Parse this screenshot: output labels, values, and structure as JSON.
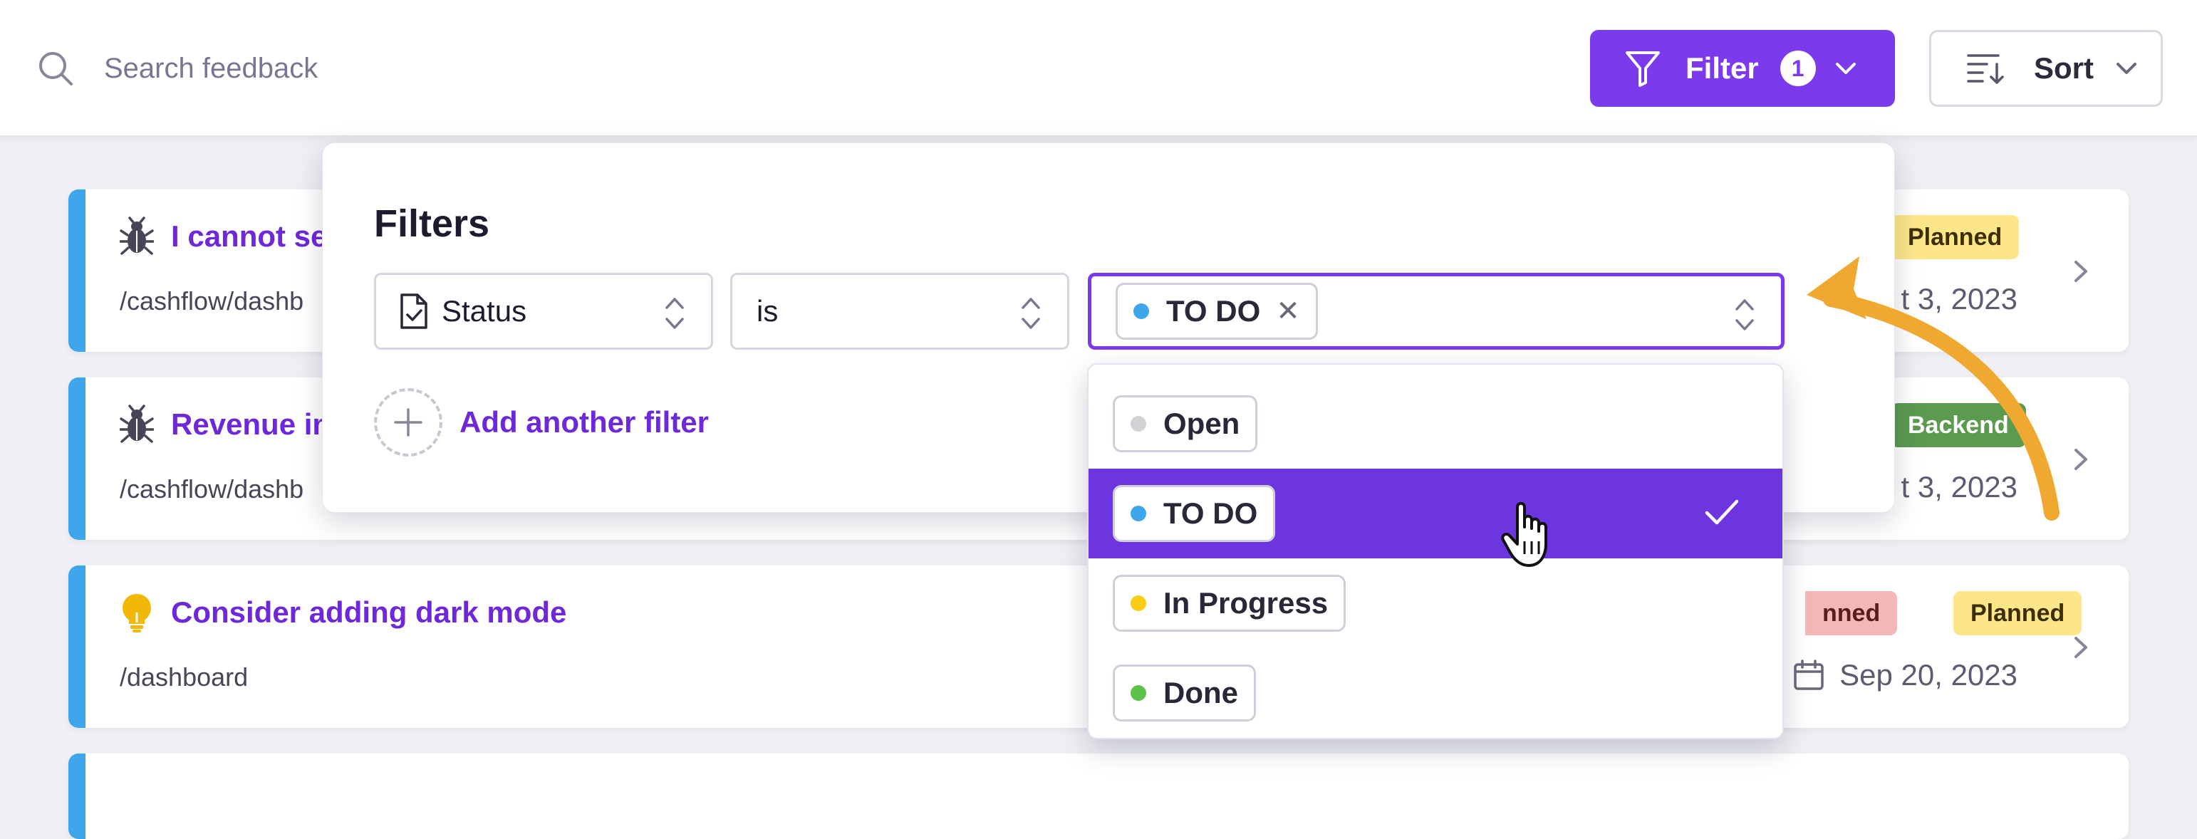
{
  "topbar": {
    "search_placeholder": "Search feedback",
    "filter_label": "Filter",
    "filter_count": "1",
    "sort_label": "Sort",
    "accent_color": "#7c3aed"
  },
  "cards": [
    {
      "type_icon": "bug-icon",
      "title": "I cannot se",
      "path": "/cashflow/dashb",
      "tags": [
        "Planned"
      ],
      "date": "t 3, 2023"
    },
    {
      "type_icon": "bug-icon",
      "title": "Revenue in",
      "path": "/cashflow/dashb",
      "tags": [
        "Backend"
      ],
      "date": "t 3, 2023"
    },
    {
      "type_icon": "lightbulb-icon",
      "title": "Consider adding dark mode",
      "path": "/dashboard",
      "tags": [
        "nned",
        "Planned"
      ],
      "date": "Sep 20, 2023"
    }
  ],
  "filters": {
    "heading": "Filters",
    "field": "Status",
    "operator": "is",
    "selected_value": "TO DO",
    "add_label": "Add another filter"
  },
  "status_options": [
    {
      "label": "Open",
      "color": "#d1d1d6",
      "selected": false
    },
    {
      "label": "TO DO",
      "color": "#3ea6ea",
      "selected": true
    },
    {
      "label": "In Progress",
      "color": "#facc15",
      "selected": false
    },
    {
      "label": "Done",
      "color": "#5cc24a",
      "selected": false
    }
  ]
}
